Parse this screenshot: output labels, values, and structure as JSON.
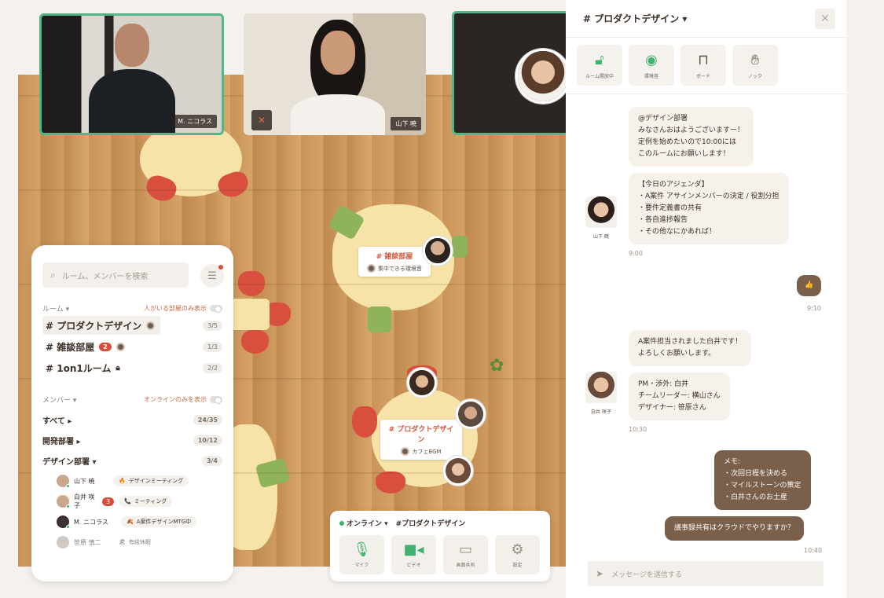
{
  "videos": [
    {
      "label": "M. ニコラス"
    },
    {
      "label": "山下 暁"
    }
  ],
  "floor_rooms": [
    {
      "name": "# 雑談部屋",
      "sub": "集中できる環境音"
    },
    {
      "name": "# プロダクトデザイン",
      "sub": "カフェBGM"
    }
  ],
  "left_panel": {
    "search_placeholder": "ルーム、メンバーを検索",
    "rooms_heading": "ルーム ▾",
    "rooms_toggle_label": "人がいる部屋のみ表示",
    "rooms": [
      {
        "name": "# プロダクトデザイン",
        "count": "3/5",
        "badge": ""
      },
      {
        "name": "# 雑談部屋",
        "count": "1/3",
        "badge": "2"
      },
      {
        "name": "# 1on1ルーム",
        "count": "2/2",
        "badge": ""
      }
    ],
    "members_heading": "メンバー ▾",
    "members_toggle_label": "オンラインのみを表示",
    "groups": [
      {
        "name": "すべて ▸",
        "count": "24/35"
      },
      {
        "name": "開発部署 ▸",
        "count": "10/12"
      },
      {
        "name": "デザイン部署 ▾",
        "count": "3/4"
      }
    ],
    "members": [
      {
        "name": "山下 暁",
        "status": "デザインミーティング",
        "status_icon": "🔥",
        "badge": ""
      },
      {
        "name": "白井 咲子",
        "status": "ミーティング",
        "status_icon": "📞",
        "badge": "3"
      },
      {
        "name": "M. ニコラス",
        "status": "A案件デザインMTG中",
        "status_icon": "🍂",
        "badge": ""
      },
      {
        "name": "笹原 慎二",
        "status": "有給休暇",
        "status_icon": "🏖",
        "badge": ""
      }
    ]
  },
  "bottom_bar": {
    "status": "オンライン ▾",
    "room": "#プロダクトデザイン",
    "buttons": [
      {
        "icon": "mic-icon",
        "label": "マイク"
      },
      {
        "icon": "video-icon",
        "label": "ビデオ"
      },
      {
        "icon": "screen-share-icon",
        "label": "画面共有"
      },
      {
        "icon": "gear-icon",
        "label": "設定"
      }
    ]
  },
  "chat": {
    "title": "# プロダクトデザイン ▾",
    "tools": [
      {
        "icon": "lock-open-icon",
        "label": "ルーム開放中"
      },
      {
        "icon": "ambient-sound-icon",
        "label": "環境音"
      },
      {
        "icon": "whiteboard-icon",
        "label": "ボード"
      },
      {
        "icon": "knock-icon",
        "label": "ノック"
      }
    ],
    "messages": [
      {
        "text": "@デザイン部署\nみなさんおはようございますー！\n定例を始めたいので10:00には\nこのルームにお願いします！"
      },
      {
        "text": "【今日のアジェンダ】\n・A案件 アサインメンバーの決定 / 役割分担\n・要件定義書の共有\n・各自進捗報告\n・その他なにかあれば！"
      },
      {
        "text": "👍"
      },
      {
        "text": "A案件担当されました白井です！\nよろしくお願いします。"
      },
      {
        "text": "PM・渉外: 白井\nチームリーダー: 横山さん\nデザイナー: 笹原さん"
      },
      {
        "text": "メモ:\n・次回日程を決める\n・マイルストーンの策定\n・白井さんのお土産"
      },
      {
        "text": "議事録共有はクラウドでやりますか？"
      }
    ],
    "times": [
      "9:00",
      "9:10",
      "10:30",
      "10:40"
    ],
    "avatar_names": [
      "山下 暁",
      "白井 咲子"
    ],
    "input_placeholder": "メッセージを送信する"
  },
  "colors": {
    "accent_green": "#3fb26f",
    "accent_red": "#d25940",
    "brown": "#7a5f4a"
  }
}
